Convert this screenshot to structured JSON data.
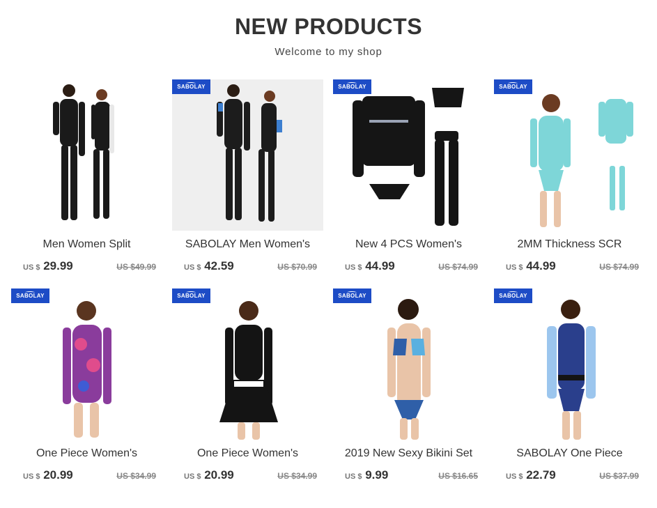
{
  "header": {
    "title": "NEW PRODUCTS",
    "subtitle": "Welcome to my shop"
  },
  "brand_label": "SABOLAY",
  "currency_prefix": "US $",
  "products": [
    {
      "name": "Men Women Split",
      "price": "29.99",
      "old_price": "US $49.99",
      "badge": false,
      "colors": {
        "suit": "#1a1a1a",
        "accent": "#e8e8e8"
      }
    },
    {
      "name": "SABOLAY Men Women's",
      "price": "42.59",
      "old_price": "US $70.99",
      "badge": true,
      "colors": {
        "suit": "#1c1c1c",
        "accent": "#3d7fd0"
      }
    },
    {
      "name": "New 4 PCS Women's",
      "price": "44.99",
      "old_price": "US $74.99",
      "badge": true,
      "colors": {
        "suit": "#151515",
        "accent": "#9aa3b5"
      }
    },
    {
      "name": "2MM Thickness SCR",
      "price": "44.99",
      "old_price": "US $74.99",
      "badge": true,
      "colors": {
        "suit": "#7ed6d8",
        "accent": "#ffffff"
      }
    },
    {
      "name": "One Piece Women's",
      "price": "20.99",
      "old_price": "US $34.99",
      "badge": true,
      "colors": {
        "suit": "#8a3c9c",
        "accent": "#e04c8c"
      }
    },
    {
      "name": "One Piece Women's",
      "price": "20.99",
      "old_price": "US $34.99",
      "badge": true,
      "colors": {
        "suit": "#141414",
        "accent": "#ffffff"
      }
    },
    {
      "name": "2019 New Sexy Bikini Set",
      "price": "9.99",
      "old_price": "US $16.65",
      "badge": true,
      "colors": {
        "suit": "#2f5fa8",
        "accent": "#5ab0e0"
      }
    },
    {
      "name": "SABOLAY One Piece",
      "price": "22.79",
      "old_price": "US $37.99",
      "badge": true,
      "colors": {
        "suit": "#2a3f8c",
        "accent": "#9cc6ee"
      }
    }
  ]
}
